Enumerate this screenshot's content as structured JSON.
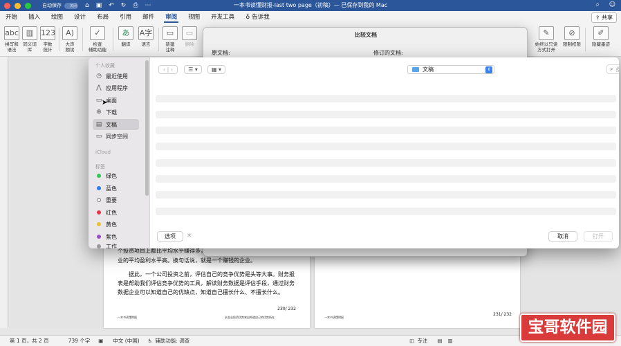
{
  "titlebar": {
    "autosave_label": "自动保存",
    "autosave_state": "关闭",
    "doc_title": "一本书读懂财报-last two page（初稿）— 已保存到我的 Mac"
  },
  "ribbon_tabs": [
    "开始",
    "插入",
    "绘图",
    "设计",
    "布局",
    "引用",
    "邮件",
    "审阅",
    "视图",
    "开发工具"
  ],
  "active_tab": "审阅",
  "tell_me": "告诉我",
  "share_label": "共享",
  "ribbon_buttons": {
    "spelling": "拼写和\n语法",
    "thesaurus": "同义词\n库",
    "word_count": "字数\n统计",
    "read_aloud": "大声\n朗读",
    "accessibility": "检查\n辅助功能",
    "translate": "翻译",
    "language": "语言",
    "new_comment": "新建\n注释",
    "delete": "删除",
    "always_open_readonly": "始终以只读\n方式打开",
    "restrict": "限制权限",
    "hide_ink": "隐藏墨迹"
  },
  "compare_dialog": {
    "title": "比较文档",
    "original_label": "原文档:",
    "revised_label": "修订的文档:"
  },
  "file_dialog": {
    "location": "文稿",
    "search_placeholder": "搜索",
    "options_label": "选项",
    "cancel_label": "取消",
    "open_label": "打开",
    "favorites_header": "个人收藏",
    "favorites": [
      {
        "label": "最近使用",
        "icon": "clock-icon",
        "glyph": "◷"
      },
      {
        "label": "应用程序",
        "icon": "apps-icon",
        "glyph": "⋀"
      },
      {
        "label": "桌面",
        "icon": "desktop-icon",
        "glyph": "▭"
      },
      {
        "label": "下载",
        "icon": "download-icon",
        "glyph": "⊕"
      },
      {
        "label": "文稿",
        "icon": "document-icon",
        "glyph": "▤"
      },
      {
        "label": "同步空间",
        "icon": "folder-icon",
        "glyph": "▭"
      }
    ],
    "selected_favorite": "文稿",
    "icloud_header": "iCloud",
    "tags_header": "标签",
    "tags": [
      {
        "label": "绿色",
        "color": "#34c759"
      },
      {
        "label": "蓝色",
        "color": "#2f7cf6"
      },
      {
        "label": "重要",
        "color": "#ffffff"
      },
      {
        "label": "红色",
        "color": "#e8344a"
      },
      {
        "label": "黄色",
        "color": "#e9c032"
      },
      {
        "label": "紫色",
        "color": "#9b4fc7"
      }
    ],
    "tag_partial": "工作"
  },
  "document": {
    "line1": "个投资项目上都比平均水平赚得多，",
    "line2": "业的平均盈利水平高。换句话说，就是一个赚钱的企业。",
    "para2_l1": "据此，一个公司投资之前，评估自己的竞争优势是头等大事。财务报",
    "para2_l2": "表是帮助我们评估竞争优势的工具，解读财务数据是评估手段，通过财务",
    "para2_l3": "数据企业可以知道自己的优缺点，知道自己擅长什么、不擅长什么。",
    "page_num_left": "230/ 232",
    "page_num_right": "231/ 232",
    "footer_left_a": "一本书读懂财报",
    "footer_left_b": "长金业投资优势来自知道自己的优势所在",
    "footer_right_a": "一本书读懂财报"
  },
  "statusbar": {
    "page": "第 1 页，共 2 页",
    "words": "739 个字",
    "language": "中文 (中国)",
    "accessibility": "辅助功能: 调查",
    "focus": "专注"
  },
  "watermark": "宝哥软件园",
  "colors": {
    "word_blue": "#2b579a",
    "finder_blue": "#3b82f0"
  }
}
